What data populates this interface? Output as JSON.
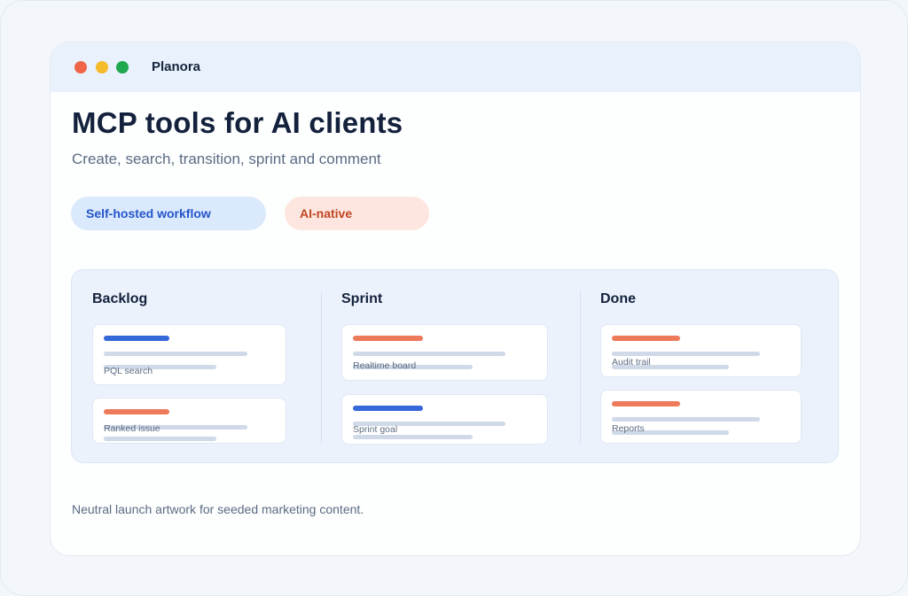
{
  "app": {
    "name": "Planora"
  },
  "hero": {
    "title": "MCP tools for AI clients",
    "subtitle": "Create, search, transition, sprint and comment"
  },
  "pills": [
    {
      "label": "Self-hosted workflow",
      "color": "#2456c9"
    },
    {
      "label": "AI-native",
      "color": "#bf4621"
    }
  ],
  "board": {
    "columns": [
      {
        "title": "Backlog",
        "cards": [
          {
            "label": "PQL search",
            "accent": "blue"
          },
          {
            "label": "Ranked issue",
            "accent": "orange"
          }
        ]
      },
      {
        "title": "Sprint",
        "cards": [
          {
            "label": "Realtime board",
            "accent": "orange"
          },
          {
            "label": "Sprint goal",
            "accent": "blue"
          }
        ]
      },
      {
        "title": "Done",
        "cards": [
          {
            "label": "Audit trail",
            "accent": "orange"
          },
          {
            "label": "Reports",
            "accent": "orange"
          }
        ]
      }
    ]
  },
  "footer": {
    "note": "Neutral launch artwork for seeded marketing content."
  },
  "colors": {
    "accent_blue": "#3568d8",
    "accent_orange": "#ee7a5c",
    "window_close": "#f06548",
    "window_minimize": "#f6bb2a",
    "window_maximize": "#1fa84f"
  }
}
